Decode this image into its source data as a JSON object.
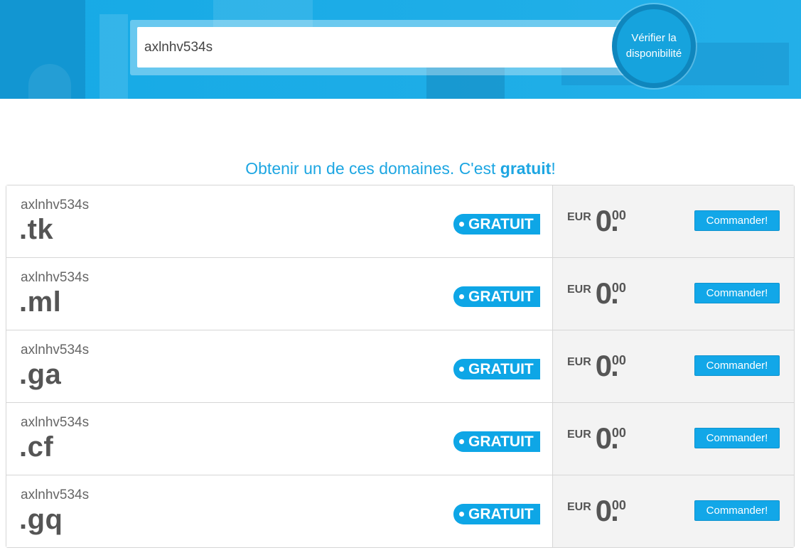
{
  "search": {
    "value": "axlnhv534s",
    "check_button_label": "Vérifier la disponibilité"
  },
  "headline": {
    "prefix": "Obtenir un de ces domaines. C'est ",
    "emphasis": "gratuit",
    "suffix": "!"
  },
  "domains": [
    {
      "name": "axlnhv534s",
      "extension": ".tk",
      "badge": "GRATUIT",
      "currency": "EUR",
      "price_int": "0",
      "price_sep": ".",
      "price_dec": "00",
      "order_label": "Commander!"
    },
    {
      "name": "axlnhv534s",
      "extension": ".ml",
      "badge": "GRATUIT",
      "currency": "EUR",
      "price_int": "0",
      "price_sep": ".",
      "price_dec": "00",
      "order_label": "Commander!"
    },
    {
      "name": "axlnhv534s",
      "extension": ".ga",
      "badge": "GRATUIT",
      "currency": "EUR",
      "price_int": "0",
      "price_sep": ".",
      "price_dec": "00",
      "order_label": "Commander!"
    },
    {
      "name": "axlnhv534s",
      "extension": ".cf",
      "badge": "GRATUIT",
      "currency": "EUR",
      "price_int": "0",
      "price_sep": ".",
      "price_dec": "00",
      "order_label": "Commander!"
    },
    {
      "name": "axlnhv534s",
      "extension": ".gq",
      "badge": "GRATUIT",
      "currency": "EUR",
      "price_int": "0",
      "price_sep": ".",
      "price_dec": "00",
      "order_label": "Commander!"
    }
  ],
  "colors": {
    "accent": "#0ea6e6",
    "banner": "#1aa9e6",
    "price_panel": "#f3f3f3"
  }
}
